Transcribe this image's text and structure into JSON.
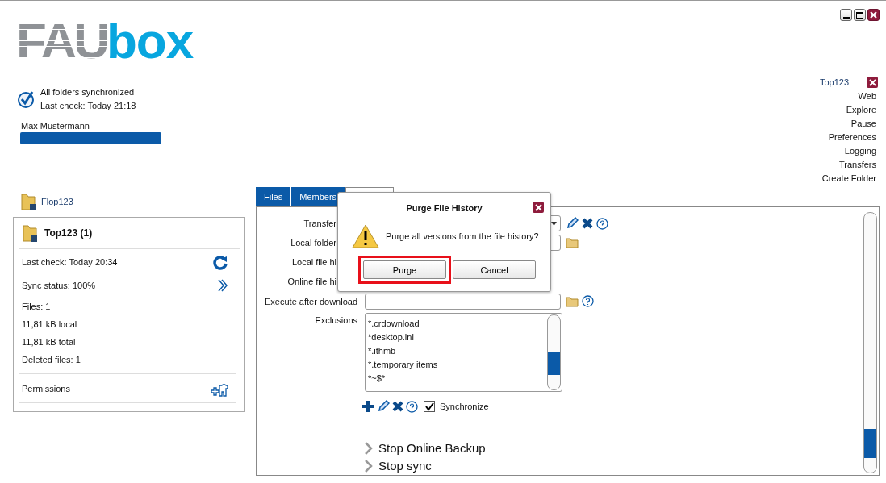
{
  "logo": {
    "part_1": "FAU",
    "part_2": "box"
  },
  "status": {
    "line_1": "All folders synchronized",
    "line_2": "Last check: Today 21:18"
  },
  "account": {
    "name": "Max Mustermann",
    "level": 1
  },
  "folder_menu": {
    "title": "Top123",
    "items": [
      "Web",
      "Explore",
      "Pause",
      "Preferences",
      "Logging",
      "Transfers",
      "Create Folder"
    ]
  },
  "folders": [
    {
      "name": "Flop123",
      "expanded": false
    },
    {
      "name": "Top123 (1)",
      "expanded": true
    }
  ],
  "folder_details": {
    "rows": [
      {
        "text": "Last check: Today 20:34",
        "kind": "refresh"
      },
      {
        "text": "Sync status: 100%",
        "kind": "more"
      },
      {
        "text": "Files: 1",
        "kind": "plain"
      },
      {
        "text": "11,81 kB local",
        "kind": "plain"
      },
      {
        "text": "11,81 kB total",
        "kind": "plain"
      },
      {
        "text": "Deleted files: 1",
        "kind": "plain"
      }
    ],
    "permissions": "Permissions"
  },
  "tabs": [
    {
      "label": "Files",
      "selected": false
    },
    {
      "label": "Members",
      "selected": false
    },
    {
      "selected": true
    }
  ],
  "form": [
    {
      "label": "Transfer",
      "covered": true,
      "kind": "dropdown"
    },
    {
      "label": "Local folder",
      "covered": true,
      "kind": "folder"
    },
    {
      "label": "Local file hi",
      "covered": true,
      "kind": "none"
    },
    {
      "label": "Online file hi",
      "covered": true,
      "kind": "none"
    },
    {
      "label": "Execute after download",
      "covered": false,
      "kind": "command"
    }
  ],
  "exclusions": {
    "label": "Exclusions",
    "items": [
      "*.crdownload",
      "*desktop.ini",
      "*.ithmb",
      "*.temporary items",
      "*~$*"
    ],
    "synchronize": {
      "label": "Synchronize",
      "checked": true
    }
  },
  "actions": [
    "Stop Online Backup",
    "Stop sync"
  ],
  "dialog": {
    "title": "Purge File History",
    "message": "Purge all versions from the file history?",
    "buttons": [
      {
        "label": "Purge",
        "highlighted": true
      },
      {
        "label": "Cancel",
        "highlighted": false
      }
    ]
  }
}
